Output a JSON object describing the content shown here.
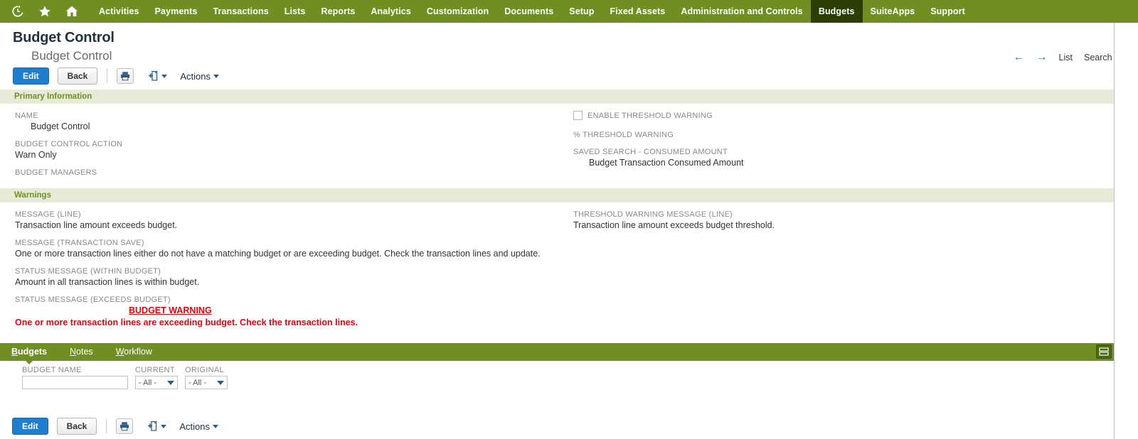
{
  "navbar": {
    "icons": [
      {
        "name": "recent-history-icon",
        "glyph": "recent"
      },
      {
        "name": "favorites-star-icon",
        "glyph": "star"
      },
      {
        "name": "home-icon",
        "glyph": "home"
      }
    ],
    "items": [
      {
        "label": "Activities",
        "active": false
      },
      {
        "label": "Payments",
        "active": false
      },
      {
        "label": "Transactions",
        "active": false
      },
      {
        "label": "Lists",
        "active": false
      },
      {
        "label": "Reports",
        "active": false
      },
      {
        "label": "Analytics",
        "active": false
      },
      {
        "label": "Customization",
        "active": false
      },
      {
        "label": "Documents",
        "active": false
      },
      {
        "label": "Setup",
        "active": false
      },
      {
        "label": "Fixed Assets",
        "active": false
      },
      {
        "label": "Administration and Controls",
        "active": false
      },
      {
        "label": "Budgets",
        "active": true
      },
      {
        "label": "SuiteApps",
        "active": false
      },
      {
        "label": "Support",
        "active": false
      }
    ],
    "accent_color": "#6f8f23",
    "active_color": "#2d3d06"
  },
  "header": {
    "record_type": "Budget Control",
    "record_name": "Budget Control",
    "back_arrow": "←",
    "forward_arrow": "→",
    "list_link": "List",
    "search_link": "Search"
  },
  "toolbar": {
    "edit_label": "Edit",
    "back_label": "Back",
    "print_icon": "printer-icon",
    "attach_icon": "new-file-icon",
    "actions_label": "Actions"
  },
  "primary_information": {
    "section_title": "Primary Information",
    "name_label": "NAME",
    "name_value": "Budget Control",
    "action_label": "BUDGET CONTROL ACTION",
    "action_value": "Warn Only",
    "managers_label": "BUDGET MANAGERS",
    "managers_value": "",
    "enable_threshold_label": "ENABLE THRESHOLD WARNING",
    "enable_threshold_checked": false,
    "pct_threshold_label": "% THRESHOLD WARNING",
    "pct_threshold_value": "",
    "saved_search_label": "SAVED SEARCH - CONSUMED AMOUNT",
    "saved_search_value": "Budget Transaction Consumed Amount"
  },
  "warnings": {
    "section_title": "Warnings",
    "message_line_label": "MESSAGE (LINE)",
    "message_line_value": "Transaction line amount exceeds budget.",
    "message_txn_save_label": "MESSAGE (TRANSACTION SAVE)",
    "message_txn_save_value": "One or more transaction lines either do not have a matching budget or are exceeding budget. Check the transaction lines and update.",
    "status_within_label": "STATUS MESSAGE (WITHIN BUDGET)",
    "status_within_value": "Amount in all transaction lines is within budget.",
    "status_exceeds_label": "STATUS MESSAGE (EXCEEDS BUDGET)",
    "status_exceeds_heading": "BUDGET WARNING",
    "status_exceeds_body": "One or more transaction lines are exceeding budget. Check the transaction lines.",
    "threshold_warning_label": "THRESHOLD WARNING MESSAGE (LINE)",
    "threshold_warning_value": "Transaction line amount exceeds budget threshold.",
    "alert_color": "#e8000d"
  },
  "subtabs": {
    "items": [
      {
        "label": "Budgets",
        "accel": "B",
        "active": true
      },
      {
        "label": "Notes",
        "accel": "N",
        "active": false
      },
      {
        "label": "Workflow",
        "accel": "W",
        "active": false
      }
    ],
    "expand_icon": "split-view-icon"
  },
  "filters": {
    "budget_name_label": "BUDGET NAME",
    "budget_name_value": "",
    "budget_name_placeholder": "",
    "current_label": "CURRENT",
    "current_value": "- All -",
    "original_label": "ORIGINAL",
    "original_value": "- All -"
  },
  "bottom_toolbar": {
    "edit_label": "Edit",
    "back_label": "Back",
    "print_icon": "printer-icon",
    "attach_icon": "new-file-icon",
    "actions_label": "Actions"
  }
}
